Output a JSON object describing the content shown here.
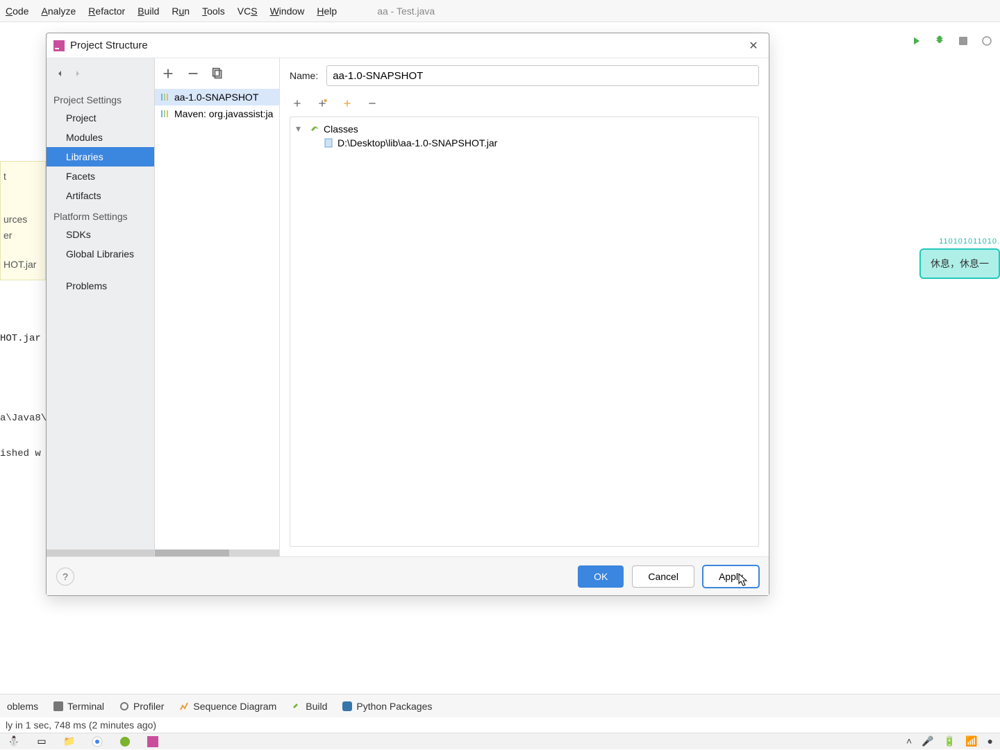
{
  "menubar": {
    "items": [
      "Code",
      "Analyze",
      "Refactor",
      "Build",
      "Run",
      "Tools",
      "VCS",
      "Window",
      "Help"
    ],
    "underlines": [
      "C",
      "A",
      "R",
      "B",
      "R",
      "T",
      "S",
      "W",
      "H"
    ],
    "tab_title": "aa - Test.java"
  },
  "background": {
    "sidebar_snippet_lines": [
      "t",
      "",
      "urces",
      "er",
      "",
      "HOT.jar"
    ],
    "jar_line": "HOT.jar",
    "code_line1": "a\\Java8\\",
    "code_line2": "ished w",
    "hint_bits": "110101011010.",
    "hint_text": "休息，休息一"
  },
  "dialog": {
    "title": "Project Structure",
    "nav": {
      "sections": [
        {
          "title": "Project Settings",
          "items": [
            "Project",
            "Modules",
            "Libraries",
            "Facets",
            "Artifacts"
          ],
          "selected_index": 2
        },
        {
          "title": "Platform Settings",
          "items": [
            "SDKs",
            "Global Libraries"
          ],
          "selected_index": -1
        },
        {
          "title": "",
          "items": [
            "Problems"
          ],
          "selected_index": -1
        }
      ]
    },
    "libs": {
      "items": [
        "aa-1.0-SNAPSHOT",
        "Maven: org.javassist:ja"
      ],
      "selected_index": 0
    },
    "detail": {
      "name_label": "Name:",
      "name_value": "aa-1.0-SNAPSHOT",
      "tree": {
        "root_label": "Classes",
        "entries": [
          "D:\\Desktop\\lib\\aa-1.0-SNAPSHOT.jar"
        ]
      }
    },
    "footer": {
      "ok": "OK",
      "cancel": "Cancel",
      "apply": "Apply"
    }
  },
  "bottom_tools": {
    "items": [
      "oblems",
      "Terminal",
      "Profiler",
      "Sequence Diagram",
      "Build",
      "Python Packages"
    ]
  },
  "status_bar": {
    "text": "ly in 1 sec, 748 ms (2 minutes ago)"
  }
}
